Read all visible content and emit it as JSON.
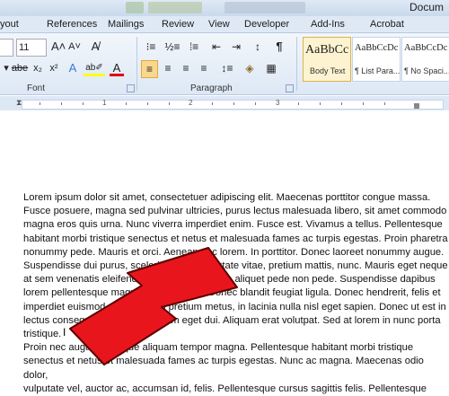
{
  "window": {
    "title": "Docum"
  },
  "tabs": [
    "yout",
    "References",
    "Mailings",
    "Review",
    "View",
    "Developer",
    "Add-Ins",
    "Acrobat"
  ],
  "font_group": {
    "size": "11",
    "grow_label": "A˄",
    "shrink_label": "A˅",
    "clear_label": "A̸",
    "strike_label": "abe",
    "subscript_label": "x₂",
    "superscript_label": "x²",
    "effects_label": "A",
    "highlight_label": "ab✐",
    "color_label": "A",
    "label": "Font"
  },
  "paragraph_group": {
    "label": "Paragraph",
    "show_marks": "¶"
  },
  "styles": [
    {
      "sample": "AaBbCc",
      "name": "Body Text"
    },
    {
      "sample": "AaBbCcDc",
      "name": "¶ List Para..."
    },
    {
      "sample": "AaBbCcDc",
      "name": "¶ No Spaci..."
    }
  ],
  "ruler": {
    "numbers": [
      "1",
      "2",
      "3"
    ]
  },
  "document": {
    "text": "Lorem ipsum dolor sit amet, consectetuer adipiscing elit. Maecenas porttitor congue massa.\nFusce posuere, magna sed pulvinar ultricies, purus lectus malesuada libero, sit amet commodo\nmagna eros quis urna. Nunc viverra imperdiet enim. Fusce est. Vivamus a tellus. Pellentesque\nhabitant morbi tristique senectus et netus et malesuada fames ac turpis egestas. Proin pharetra\nnonummy pede. Mauris et orci. Aenean nec lorem. In porttitor. Donec laoreet nonummy augue.\nSuspendisse dui purus, scelerisque at, vulputate vitae, pretium mattis, nunc. Mauris eget neque\nat sem venenatis eleifend. Ut nonummy. Fusce aliquet pede non pede. Suspendisse dapibus\nlorem pellentesque magna. Integer nulla. Donec blandit feugiat ligula. Donec hendrerit, felis et\nimperdiet euismod, purus ipsum pretium metus, in lacinia nulla nisl eget sapien. Donec ut est in\nlectus consequat consequat. Etiam eget dui. Aliquam erat volutpat. Sed at lorem in nunc porta\ntristique.\nProin nec augue. Quisque aliquam tempor magna. Pellentesque habitant morbi tristique\nsenectus et netus et malesuada fames ac turpis egestas. Nunc ac magna. Maecenas odio dolor,\nvulputate vel, auctor ac, accumsan id, felis. Pellentesque cursus sagittis felis. Pellentesque"
  },
  "colors": {
    "arrow": "#e8161c",
    "arrow_outline": "#5a0000",
    "ribbon": "#dde8f5",
    "font_color": "#e00000"
  }
}
